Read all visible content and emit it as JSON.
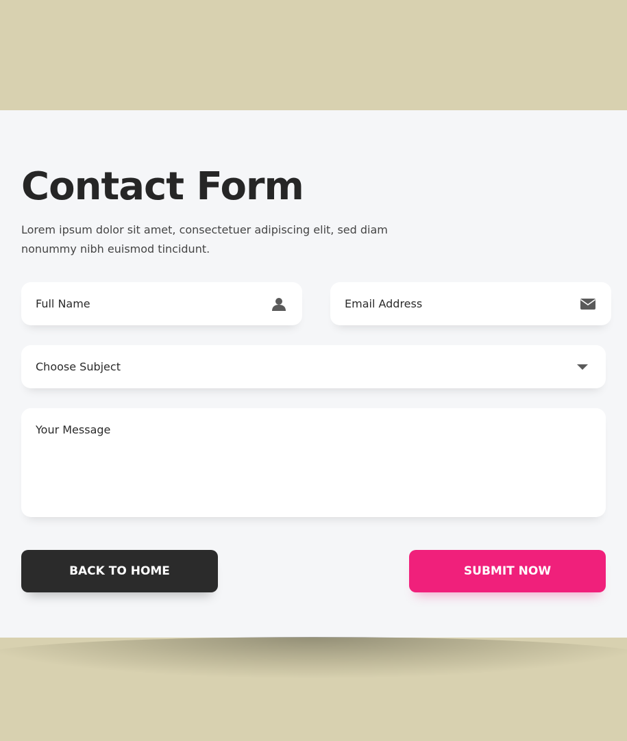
{
  "page": {
    "title": "Contact Form",
    "description": "Lorem ipsum dolor sit amet, consectetuer adipiscing elit, sed diam nonummy nibh euismod tincidunt."
  },
  "form": {
    "name_placeholder": "Full Name",
    "name_icon": "user-icon",
    "email_placeholder": "Email Address",
    "email_icon": "envelope-icon",
    "subject_placeholder": "Choose Subject",
    "subject_icon": "caret-down-icon",
    "message_placeholder": "Your Message"
  },
  "buttons": {
    "back_label": "BACK TO HOME",
    "submit_label": "SUBMIT NOW"
  },
  "colors": {
    "backdrop": "#d8d1b0",
    "card": "#f5f6f8",
    "back_button": "#2b2b2b",
    "submit_button": "#f0207b",
    "icon": "#5a5a5a"
  }
}
